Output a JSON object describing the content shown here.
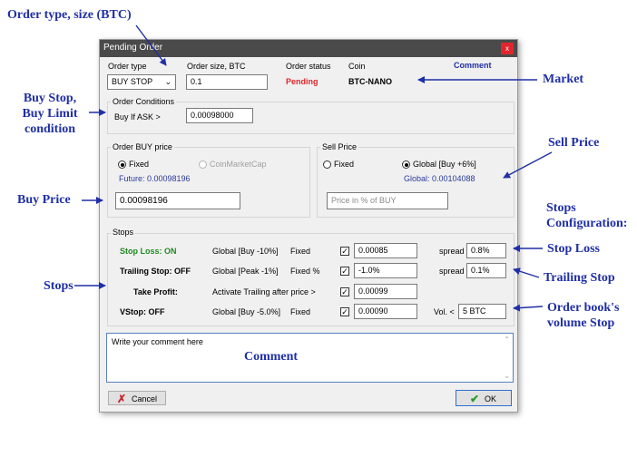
{
  "annotations": {
    "order_type_size": "Order type, size (BTC)",
    "buy_stop_limit": [
      "Buy Stop,",
      "Buy Limit",
      "condition"
    ],
    "market": "Market",
    "sell_price": "Sell Price",
    "buy_price": "Buy Price",
    "stops_configuration": [
      "Stops",
      "Configuration:"
    ],
    "stop_loss": "Stop Loss",
    "trailing_stop": "Trailing Stop",
    "stops": "Stops",
    "order_book_stop": [
      "Order book's",
      "volume Stop"
    ],
    "comment_overlay": "Comment"
  },
  "window": {
    "title": "Pending Order",
    "close_glyph": "x"
  },
  "header": {
    "order_type_label": "Order type",
    "order_type_value": "BUY STOP",
    "order_size_label": "Order size, BTC",
    "order_size_value": "0.1",
    "order_status_label": "Order status",
    "order_status_value": "Pending",
    "coin_label": "Coin",
    "coin_value": "BTC-NANO",
    "comment_link": "Comment"
  },
  "conditions": {
    "group_label": "Order Conditions",
    "buy_if_label": "Buy If ASK >",
    "buy_if_value": "0.00098000"
  },
  "buy_price": {
    "group_label": "Order BUY price",
    "fixed_label": "Fixed",
    "coinmarketcap_label": "CoinMarketCap",
    "future_text": "Future: 0.00098196",
    "price_value": "0.00098196"
  },
  "sell_price": {
    "group_label": "Sell Price",
    "fixed_label": "Fixed",
    "global_label": "Global [Buy +6%]",
    "global_text": "Global: 0.00104088",
    "placeholder": "Price in % of BUY"
  },
  "stops": {
    "group_label": "Stops",
    "rows": [
      {
        "name": "Stop Loss: ON",
        "rule": "Global [Buy -10%]",
        "mode": "Fixed",
        "value": "0.00085",
        "extra_label": "spread",
        "extra_value": "0.8%"
      },
      {
        "name": "Trailing Stop: OFF",
        "rule": "Global [Peak -1%]",
        "mode": "Fixed %",
        "value": "-1.0%",
        "extra_label": "spread",
        "extra_value": "0.1%"
      },
      {
        "name": "Take Profit:",
        "rule": "Activate Trailing after price >",
        "mode": "",
        "value": "0.00099",
        "extra_label": "",
        "extra_value": ""
      },
      {
        "name": "VStop: OFF",
        "rule": "Global [Buy -5.0%]",
        "mode": "Fixed",
        "value": "0.00090",
        "extra_label": "Vol. <",
        "extra_value": "5 BTC"
      }
    ]
  },
  "comment": {
    "placeholder": "Write your comment here"
  },
  "buttons": {
    "cancel": "Cancel",
    "ok": "OK"
  },
  "colors": {
    "accent_blue": "#1f2fa6",
    "pending_red": "#e0262c",
    "stop_on_green": "#1f8a1f",
    "future_blue": "#2a3a9a",
    "titlebar": "#4a4a4a"
  }
}
